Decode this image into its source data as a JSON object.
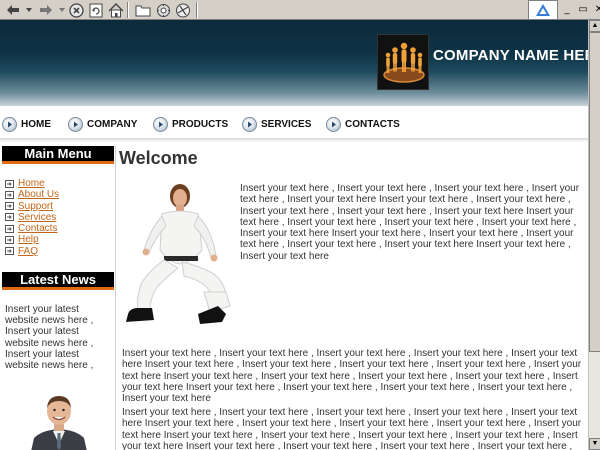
{
  "browser": {
    "toolbar_icons": [
      "back-arrow-icon",
      "dropdown-icon",
      "forward-arrow-icon",
      "dropdown-icon",
      "stop-icon",
      "refresh-icon",
      "home-icon",
      "folder-icon",
      "settings-icon",
      "favorites-icon"
    ],
    "window_controls": [
      "minimize",
      "restore",
      "close"
    ],
    "minimize_glyph": "_",
    "restore_glyph": "▭",
    "close_glyph": "✕"
  },
  "header": {
    "company_name": "COMPANY NAME HERE",
    "colors": {
      "banner_dark": "#0b2a3a",
      "accent_orange": "#e06a10",
      "logo_bg": "#111111"
    }
  },
  "nav": {
    "items": [
      {
        "label": "HOME"
      },
      {
        "label": "COMPANY"
      },
      {
        "label": "PRODUCTS"
      },
      {
        "label": "SERVICES"
      },
      {
        "label": "CONTACTS"
      }
    ]
  },
  "sidebar": {
    "main_menu_title": "Main Menu",
    "menu_items": [
      {
        "label": "Home"
      },
      {
        "label": "About Us"
      },
      {
        "label": "Support"
      },
      {
        "label": "Services"
      },
      {
        "label": "Contacts"
      },
      {
        "label": "Help"
      },
      {
        "label": "FAQ"
      }
    ],
    "latest_news_title": "Latest News",
    "news_text": "Insert your latest website news here , Insert your latest website news here , Insert your latest website news here ,"
  },
  "main": {
    "title": "Welcome",
    "intro_text": "Insert your text here , Insert your text here , Insert your text here , Insert your text here , Insert your text here Insert your text here , Insert your text here , Insert your text here , Insert your text here , Insert your text here Insert your text here , Insert your text here , Insert your text here , Insert your text here , Insert your text here Insert your text here , Insert your text here , Insert your text here , Insert your text here , Insert your text here Insert your text here , Insert your text here",
    "paragraph1": "Insert your text here , Insert your text here , Insert your text here , Insert your text here , Insert your text here Insert your text here , Insert your text here , Insert your text here , Insert your text here , Insert your text here Insert your text here , Insert your text here , Insert your text here , Insert your text here , Insert your text here Insert your text here , Insert your text here , Insert your text here , Insert your text here , Insert your text here",
    "paragraph2": "Insert your text here , Insert your text here , Insert your text here , Insert your text here , Insert your text here Insert your text here , Insert your text here , Insert your text here , Insert your text here , Insert your text here Insert your text here , Insert your text here , Insert your text here , Insert your text here , Insert your text here Insert your text here , Insert your text here , Insert your text here , Insert your text here , Insert your text here"
  }
}
